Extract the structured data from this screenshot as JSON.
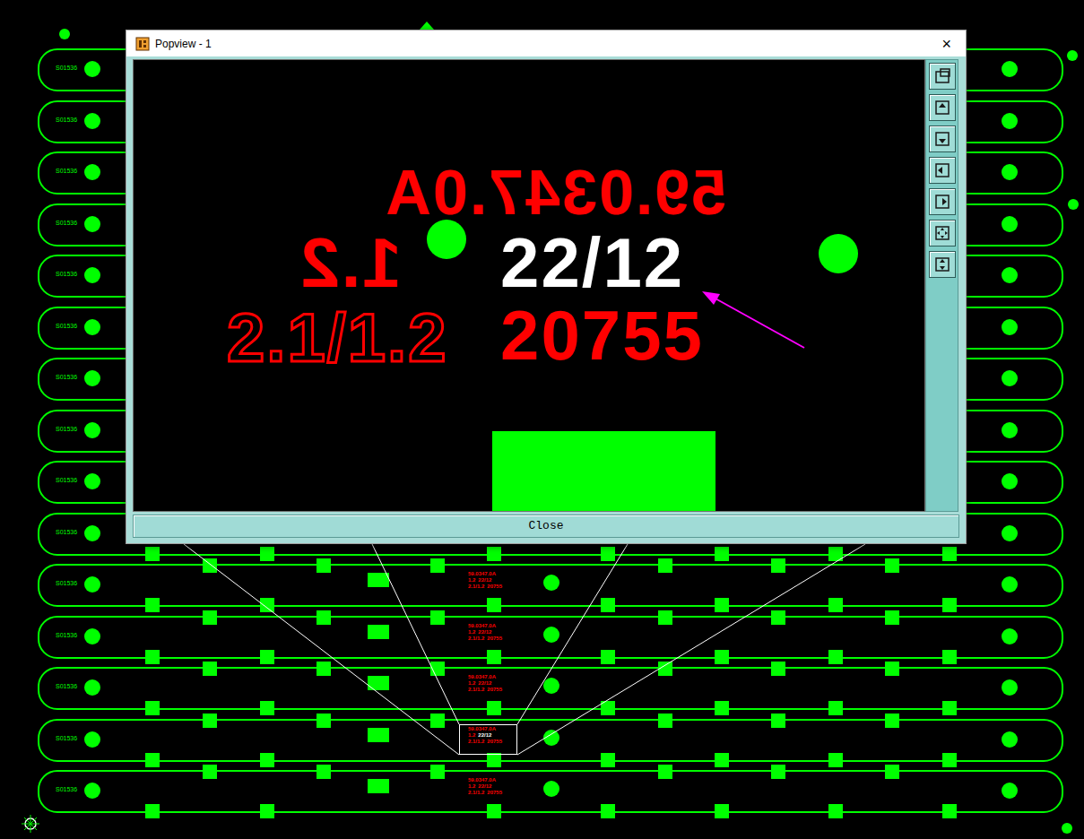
{
  "popview": {
    "title": "Popview - 1",
    "close_icon": "×",
    "close_button": "Close",
    "labels": [
      {
        "text": "59.0347.0A",
        "color": "#ff0000",
        "mirrored": true,
        "outlined": false
      },
      {
        "text": "1.2",
        "color": "#ff0000",
        "mirrored": true,
        "outlined": false
      },
      {
        "text": "22/12",
        "color": "#ffffff",
        "mirrored": false,
        "outlined": false
      },
      {
        "text": "2.1/1.2",
        "color": "#ff0000",
        "mirrored": false,
        "outlined": true
      },
      {
        "text": "20755",
        "color": "#ff0000",
        "mirrored": false,
        "outlined": false
      }
    ]
  },
  "board": {
    "rows": [
      {
        "label": "S01536",
        "tagged": false,
        "highlighted": false
      },
      {
        "label": "S01536",
        "tagged": false,
        "highlighted": false
      },
      {
        "label": "S01536",
        "tagged": false,
        "highlighted": false
      },
      {
        "label": "S01536",
        "tagged": false,
        "highlighted": false
      },
      {
        "label": "S01536",
        "tagged": false,
        "highlighted": false
      },
      {
        "label": "S01536",
        "tagged": false,
        "highlighted": false
      },
      {
        "label": "S01536",
        "tagged": false,
        "highlighted": false
      },
      {
        "label": "S01536",
        "tagged": false,
        "highlighted": false
      },
      {
        "label": "S01536",
        "tagged": false,
        "highlighted": false
      },
      {
        "label": "S01536",
        "tagged": false,
        "highlighted": false
      },
      {
        "label": "S01536",
        "tagged": true,
        "highlighted": false
      },
      {
        "label": "S01536",
        "tagged": true,
        "highlighted": false
      },
      {
        "label": "S01536",
        "tagged": true,
        "highlighted": false
      },
      {
        "label": "S01536",
        "tagged": true,
        "highlighted": true
      },
      {
        "label": "S01536",
        "tagged": true,
        "highlighted": false
      }
    ]
  }
}
